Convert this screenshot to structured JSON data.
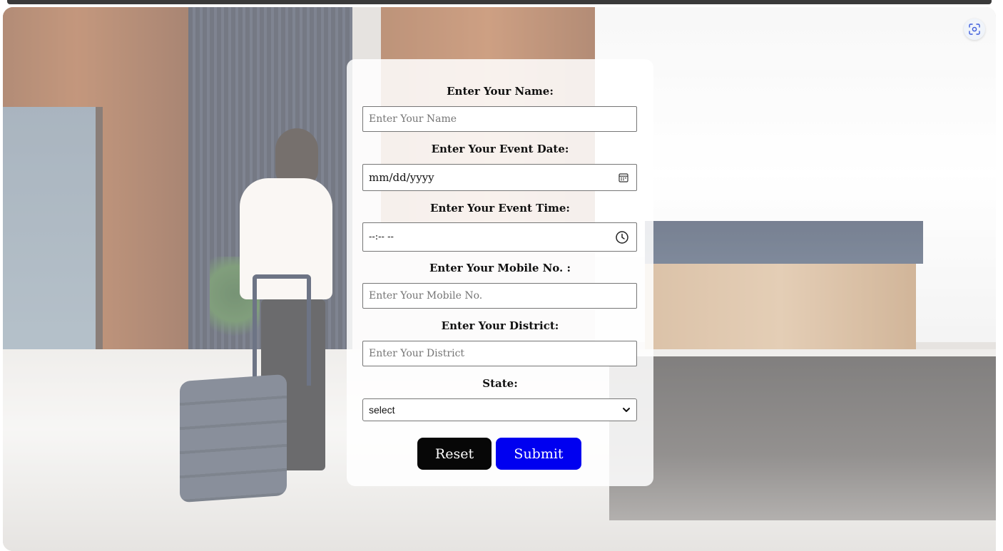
{
  "form": {
    "name": {
      "label": "Enter Your Name:",
      "placeholder": "Enter Your Name"
    },
    "event_date": {
      "label": "Enter Your Event Date:",
      "value": "mm/dd/yyyy",
      "icon": "calendar-icon"
    },
    "event_time": {
      "label": "Enter Your Event Time:",
      "value": "--:-- --",
      "icon": "clock-icon"
    },
    "mobile": {
      "label": "Enter Your Mobile No. :",
      "placeholder": "Enter Your Mobile No."
    },
    "district": {
      "label": "Enter Your District:",
      "placeholder": "Enter Your District"
    },
    "state": {
      "label": "State:",
      "selected": "select",
      "icon": "chevron-down-icon"
    },
    "buttons": {
      "reset_label": "Reset",
      "submit_label": "Submit"
    }
  },
  "toolbar": {
    "screenshot_icon": "screenshot-icon"
  },
  "colors": {
    "reset_bg": "#070707",
    "submit_bg": "#0000f0",
    "card_bg": "#ffffff",
    "top_bar": "#3a3a3a"
  }
}
